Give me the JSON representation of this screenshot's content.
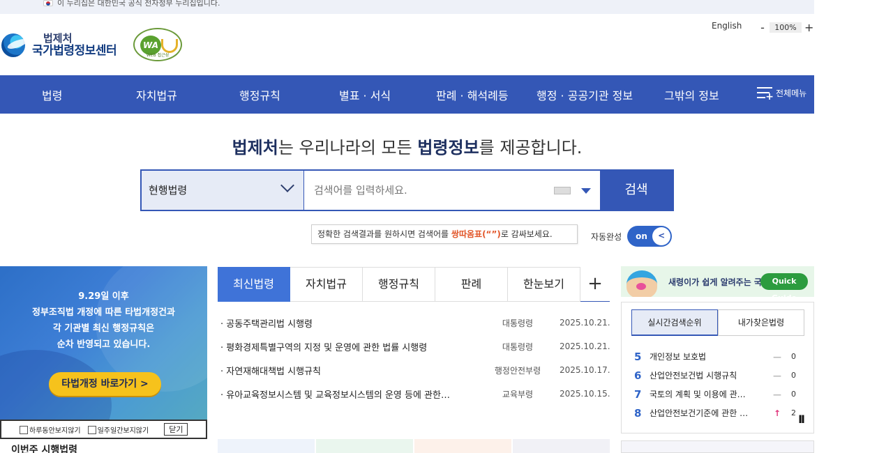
{
  "gov_banner": {
    "text": "이 누리집은 대한민국 공식 전자정부 누리집입니다."
  },
  "logo": {
    "line1": "법제처",
    "line2": "국가법령정보센터"
  },
  "wa_badge": {
    "mark": "WA",
    "caption": "WEB 접근성"
  },
  "header": {
    "lang": "English",
    "zoom_minus": "-",
    "zoom_value": "100%",
    "zoom_plus": "+"
  },
  "nav": {
    "items": [
      "법령",
      "자치법규",
      "행정규칙",
      "별표 · 서식",
      "판례 · 해석례등",
      "행정 · 공공기관 정보",
      "그밖의 정보"
    ],
    "all_menu": "전체메뉴"
  },
  "headline": {
    "brand": "법제처",
    "mid": "는 우리나라의 모든 ",
    "emph": "법령정보",
    "tail": "를 제공합니다."
  },
  "search": {
    "scope": "현행법령",
    "placeholder": "검색어를 입력하세요.",
    "button": "검색",
    "tip_pre": "정확한 검색결과를 원하시면 검색어를 ",
    "tip_quote": "쌍따옴표(“”)",
    "tip_post": "로  감싸보세요.",
    "autocomplete_label": "자동완성",
    "toggle": "on",
    "toggle_knob": "<"
  },
  "left_banner": {
    "lines": [
      "9.29일 이후",
      "정부조직법 개정에 따른 타법개정건과",
      "각 기관별 최신 행정규칙은",
      "순차 반영되고 있습니다."
    ],
    "cta": "타법개정 바로가기 >",
    "opt1": "하루동안보지않기",
    "opt2": "일주일간보지않기",
    "close": "닫기",
    "next_title": "이번주 시행법령"
  },
  "tabs": {
    "items": [
      "최신법령",
      "자치법규",
      "행정규칙",
      "판례",
      "한눈보기"
    ],
    "plus": "+"
  },
  "laws": [
    {
      "title": "· 공동주택관리법 시행령",
      "dept": "대통령령",
      "date": "2025.10.21."
    },
    {
      "title": "· 평화경제특별구역의 지정 및 운영에 관한 법률 시행령",
      "dept": "대통령령",
      "date": "2025.10.21."
    },
    {
      "title": "· 자연재해대책법 시행규칙",
      "dept": "행정안전부령",
      "date": "2025.10.17."
    },
    {
      "title": "· 유아교육정보시스템 및 교육정보시스템의 운영 등에 관한…",
      "dept": "교육부령",
      "date": "2025.10.15."
    }
  ],
  "quick_guide": {
    "text": "새령이가 쉽게 알려주는 국법",
    "button": "Quick Guide"
  },
  "ranking": {
    "tabs": [
      "실시간검색순위",
      "내가찾은법령"
    ],
    "items": [
      {
        "rank": "5",
        "name": "개인정보 보호법",
        "trend": "—",
        "change": "0"
      },
      {
        "rank": "6",
        "name": "산업안전보건법 시행규칙",
        "trend": "—",
        "change": "0"
      },
      {
        "rank": "7",
        "name": "국토의 계획 및 이용에 관…",
        "trend": "—",
        "change": "0"
      },
      {
        "rank": "8",
        "name": "산업안전보건기준에 관한 …",
        "trend": "↑",
        "change": "2"
      }
    ],
    "pause": "II"
  },
  "colors": {
    "primary": "#3457b6",
    "active_tab": "#3f73d8",
    "quote": "#e2572b",
    "cta": "#f6c21c"
  }
}
